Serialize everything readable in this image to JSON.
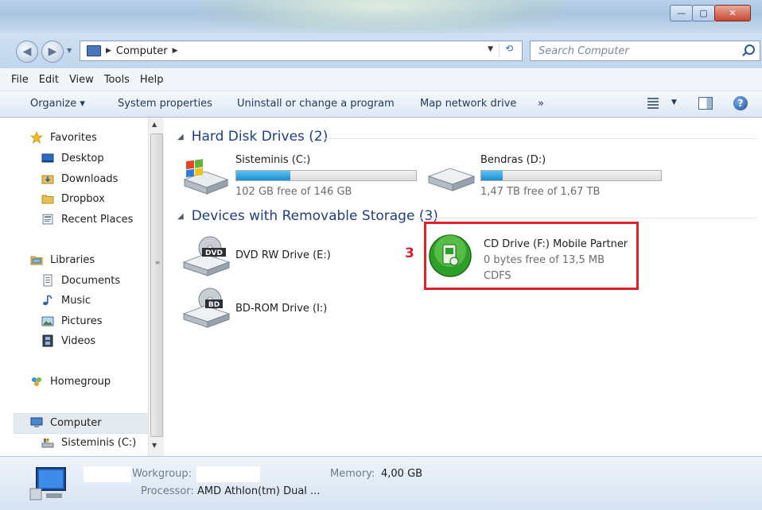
{
  "window": {
    "caption": {
      "minimize": "—",
      "maximize": "▢",
      "close": "✕"
    }
  },
  "address": {
    "crumbs": [
      "Computer"
    ],
    "search_placeholder": "Search Computer"
  },
  "menu": [
    "File",
    "Edit",
    "View",
    "Tools",
    "Help"
  ],
  "command_bar": {
    "organize": "Organize ▾",
    "system_properties": "System properties",
    "uninstall": "Uninstall or change a program",
    "map_drive": "Map network drive",
    "more": "»"
  },
  "nav": {
    "favorites": "Favorites",
    "desktop": "Desktop",
    "downloads": "Downloads",
    "dropbox": "Dropbox",
    "recent_places": "Recent Places",
    "libraries": "Libraries",
    "documents": "Documents",
    "music": "Music",
    "pictures": "Pictures",
    "videos": "Videos",
    "homegroup": "Homegroup",
    "computer": "Computer",
    "sisteminis": "Sisteminis (C:)"
  },
  "groups": {
    "hard_disk": "Hard Disk Drives (2)",
    "removable": "Devices with Removable Storage (3)"
  },
  "drives": {
    "c": {
      "name": "Sisteminis (C:)",
      "free": "102 GB free of 146 GB",
      "used_fraction": 0.3
    },
    "d": {
      "name": "Bendras (D:)",
      "free": "1,47 TB free of 1,67 TB",
      "used_fraction": 0.12
    },
    "dvd": {
      "name": "DVD RW Drive (E:)",
      "badge": "DVD"
    },
    "bd": {
      "name": "BD-ROM Drive (I:)",
      "badge": "BD"
    },
    "cd": {
      "name": "CD Drive (F:) Mobile Partner",
      "free": "0 bytes free of 13,5 MB",
      "fs": "CDFS"
    }
  },
  "annotation": "3",
  "details": {
    "workgroup_label": "Workgroup:",
    "memory_label": "Memory:",
    "memory_value": "4,00 GB",
    "processor_label": "Processor:",
    "processor_value": "AMD Athlon(tm) Dual ..."
  },
  "colors": {
    "highlight": "#e0202a",
    "group_header": "#1e3f84",
    "bar_fill": "#1a8fd0"
  }
}
